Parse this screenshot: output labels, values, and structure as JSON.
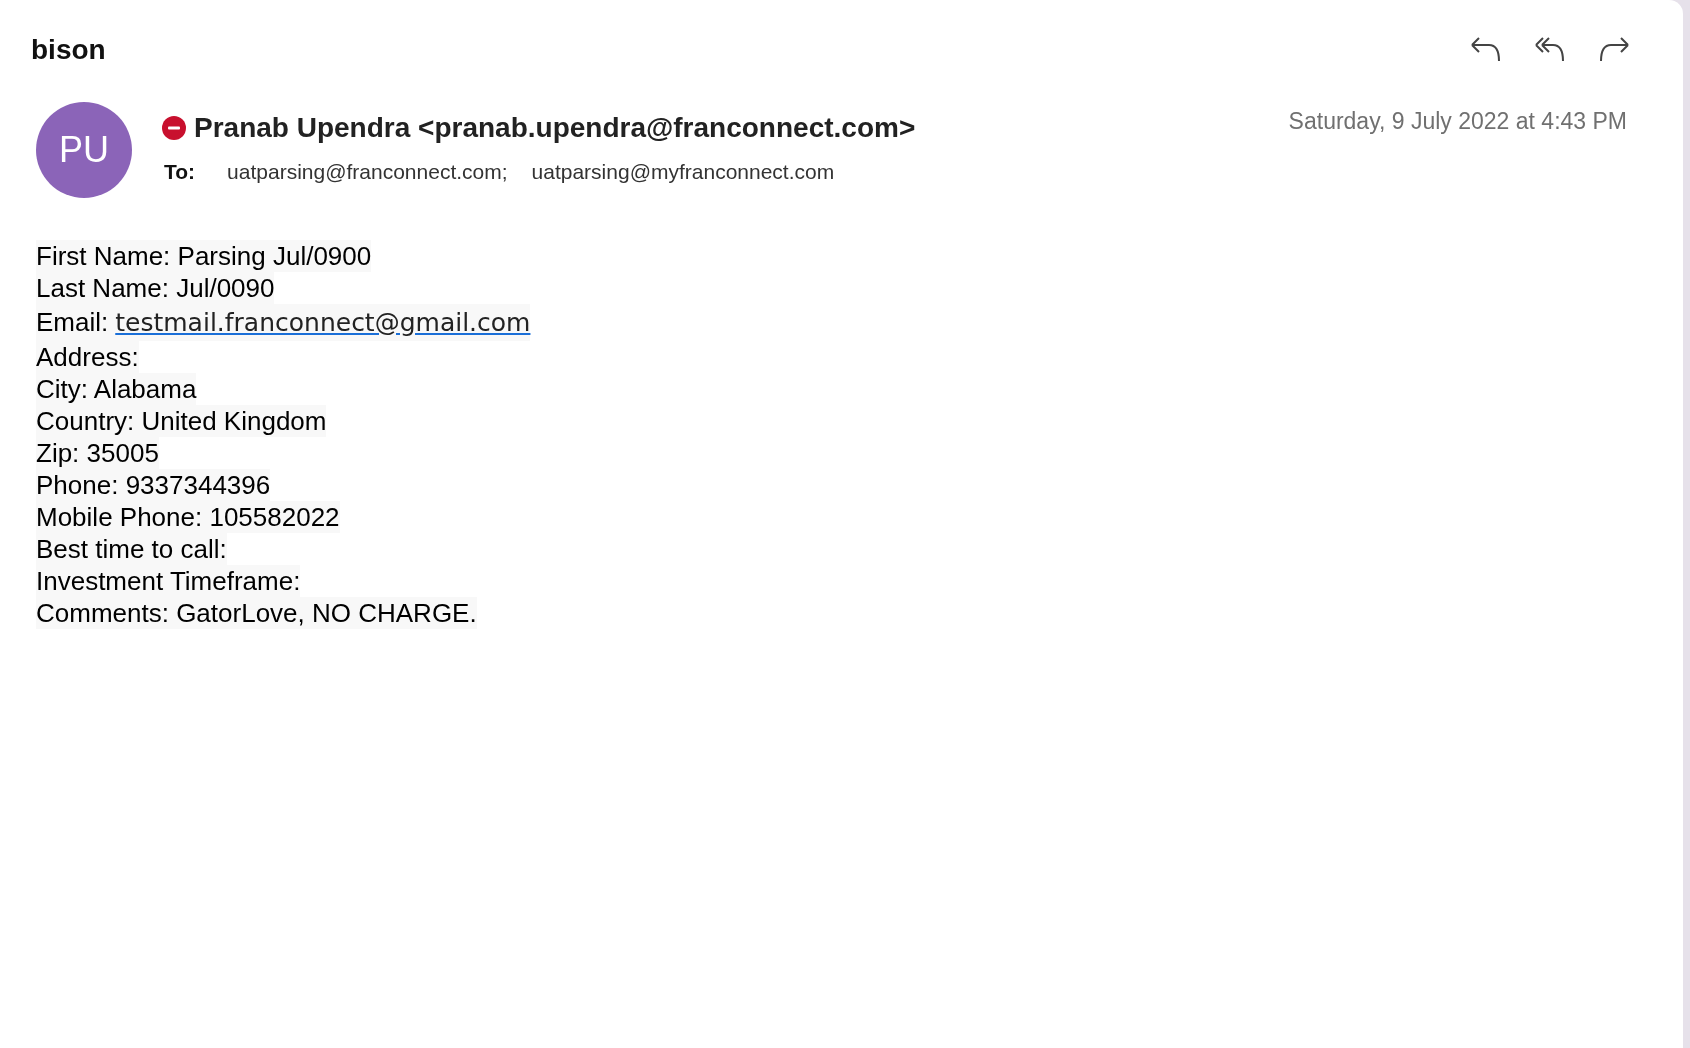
{
  "subject": "bison",
  "sender": {
    "initials": "PU",
    "display": "Pranab Upendra <pranab.upendra@franconnect.com>",
    "blocked": true
  },
  "to": {
    "label": "To:",
    "recipients": [
      "uatparsing@franconnect.com;",
      "uatparsing@myfranconnect.com"
    ]
  },
  "date": "Saturday, 9 July 2022 at 4:43 PM",
  "body": [
    {
      "kind": "text",
      "text": "First Name: Parsing Jul/0900"
    },
    {
      "kind": "text",
      "text": "Last Name: Jul/0090"
    },
    {
      "kind": "link",
      "label": "Email:",
      "link": "testmail.franconnect@gmail.com"
    },
    {
      "kind": "text",
      "text": "Address:"
    },
    {
      "kind": "text",
      "text": "City: Alabama"
    },
    {
      "kind": "text",
      "text": "Country: United Kingdom"
    },
    {
      "kind": "text",
      "text": "Zip: 35005"
    },
    {
      "kind": "text",
      "text": "Phone: 9337344396"
    },
    {
      "kind": "text",
      "text": "Mobile Phone: 105582022"
    },
    {
      "kind": "text",
      "text": "Best time to call:"
    },
    {
      "kind": "text",
      "text": "Investment Timeframe:"
    },
    {
      "kind": "text",
      "text": "Comments: GatorLove, NO CHARGE."
    }
  ]
}
